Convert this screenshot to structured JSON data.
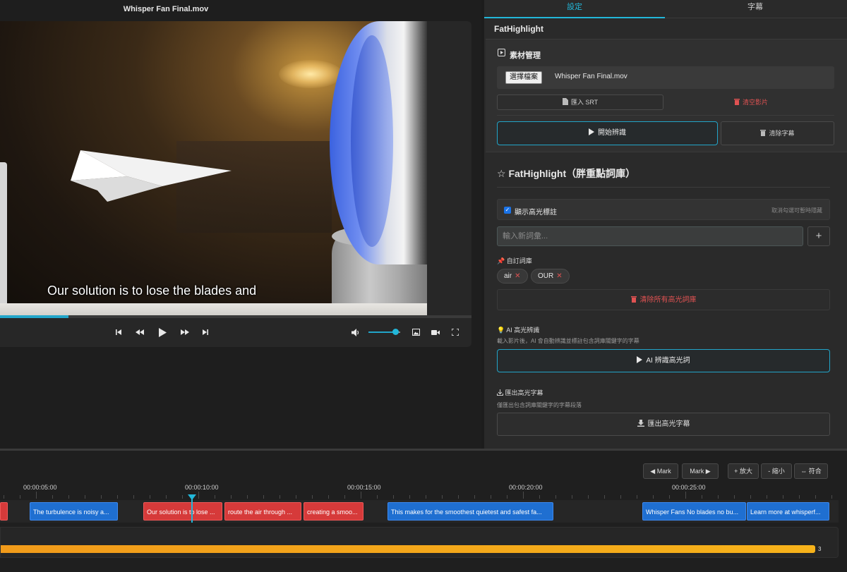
{
  "player": {
    "title": "Whisper Fan Final.mov",
    "subtitle": "Our solution is to lose the blades and",
    "progress": 0.145,
    "volume": 0.85
  },
  "tabs": [
    {
      "label": "設定",
      "active": true
    },
    {
      "label": "字幕",
      "active": false
    }
  ],
  "app_name": "FatHighlight",
  "assets": {
    "title": "素材管理",
    "file_button": "選擇檔案",
    "file_name": "Whisper Fan Final.mov",
    "import_srt": "匯入 SRT",
    "clear_video": "清空影片",
    "start_recognition": "開始辨識",
    "clear_subtitles": "清除字幕"
  },
  "highlight": {
    "title": "FatHighlight（胖重點詞庫）",
    "toggle_label": "顯示高光標註",
    "toggle_checked": true,
    "toggle_hint": "取消勾選可暫時隱藏",
    "input_placeholder": "輸入新詞彙...",
    "add_label": "+",
    "custom_title": "自訂詞庫",
    "words": [
      "air",
      "OUR"
    ],
    "clear_all": "清除所有高光詞庫",
    "ai_title": "AI 高光辨識",
    "ai_desc": "載入影片後，AI 會自動辨識並標註包含詞庫關鍵字的字幕",
    "ai_button": "AI 辨識高光詞",
    "export_title": "匯出高光字幕",
    "export_desc": "僅匯出包含詞庫關鍵字的字幕段落",
    "export_button": "匯出高光字幕"
  },
  "timeline": {
    "buttons": {
      "prev_mark": "◀ Mark",
      "next_mark": "Mark ▶",
      "zoom_in": "+ 放大",
      "zoom_out": "- 縮小",
      "fit": "⇔ 符合"
    },
    "time_labels": [
      "00:00:05:00",
      "00:00:10:00",
      "00:00:15:00",
      "00:00:20:00",
      "00:00:25:00"
    ],
    "segments": [
      {
        "text": "",
        "color": "red"
      },
      {
        "text": "The turbulence is noisy a...",
        "color": "blue"
      },
      {
        "text": "Our solution is to lose ...",
        "color": "red"
      },
      {
        "text": "route the air through ...",
        "color": "red"
      },
      {
        "text": "creating a smoo...",
        "color": "red"
      },
      {
        "text": "This makes for the smoothest quietest and safest fa...",
        "color": "blue"
      },
      {
        "text": "Whisper Fans No blades no bu...",
        "color": "blue"
      },
      {
        "text": "Learn more at whisperf...",
        "color": "blue"
      }
    ],
    "heat_value": "3"
  },
  "colors": {
    "accent": "#22b7d9",
    "danger": "#e05252",
    "segment_blue": "#1f6fd1",
    "segment_red": "#d63a3a",
    "heat": "#f6b21a"
  }
}
